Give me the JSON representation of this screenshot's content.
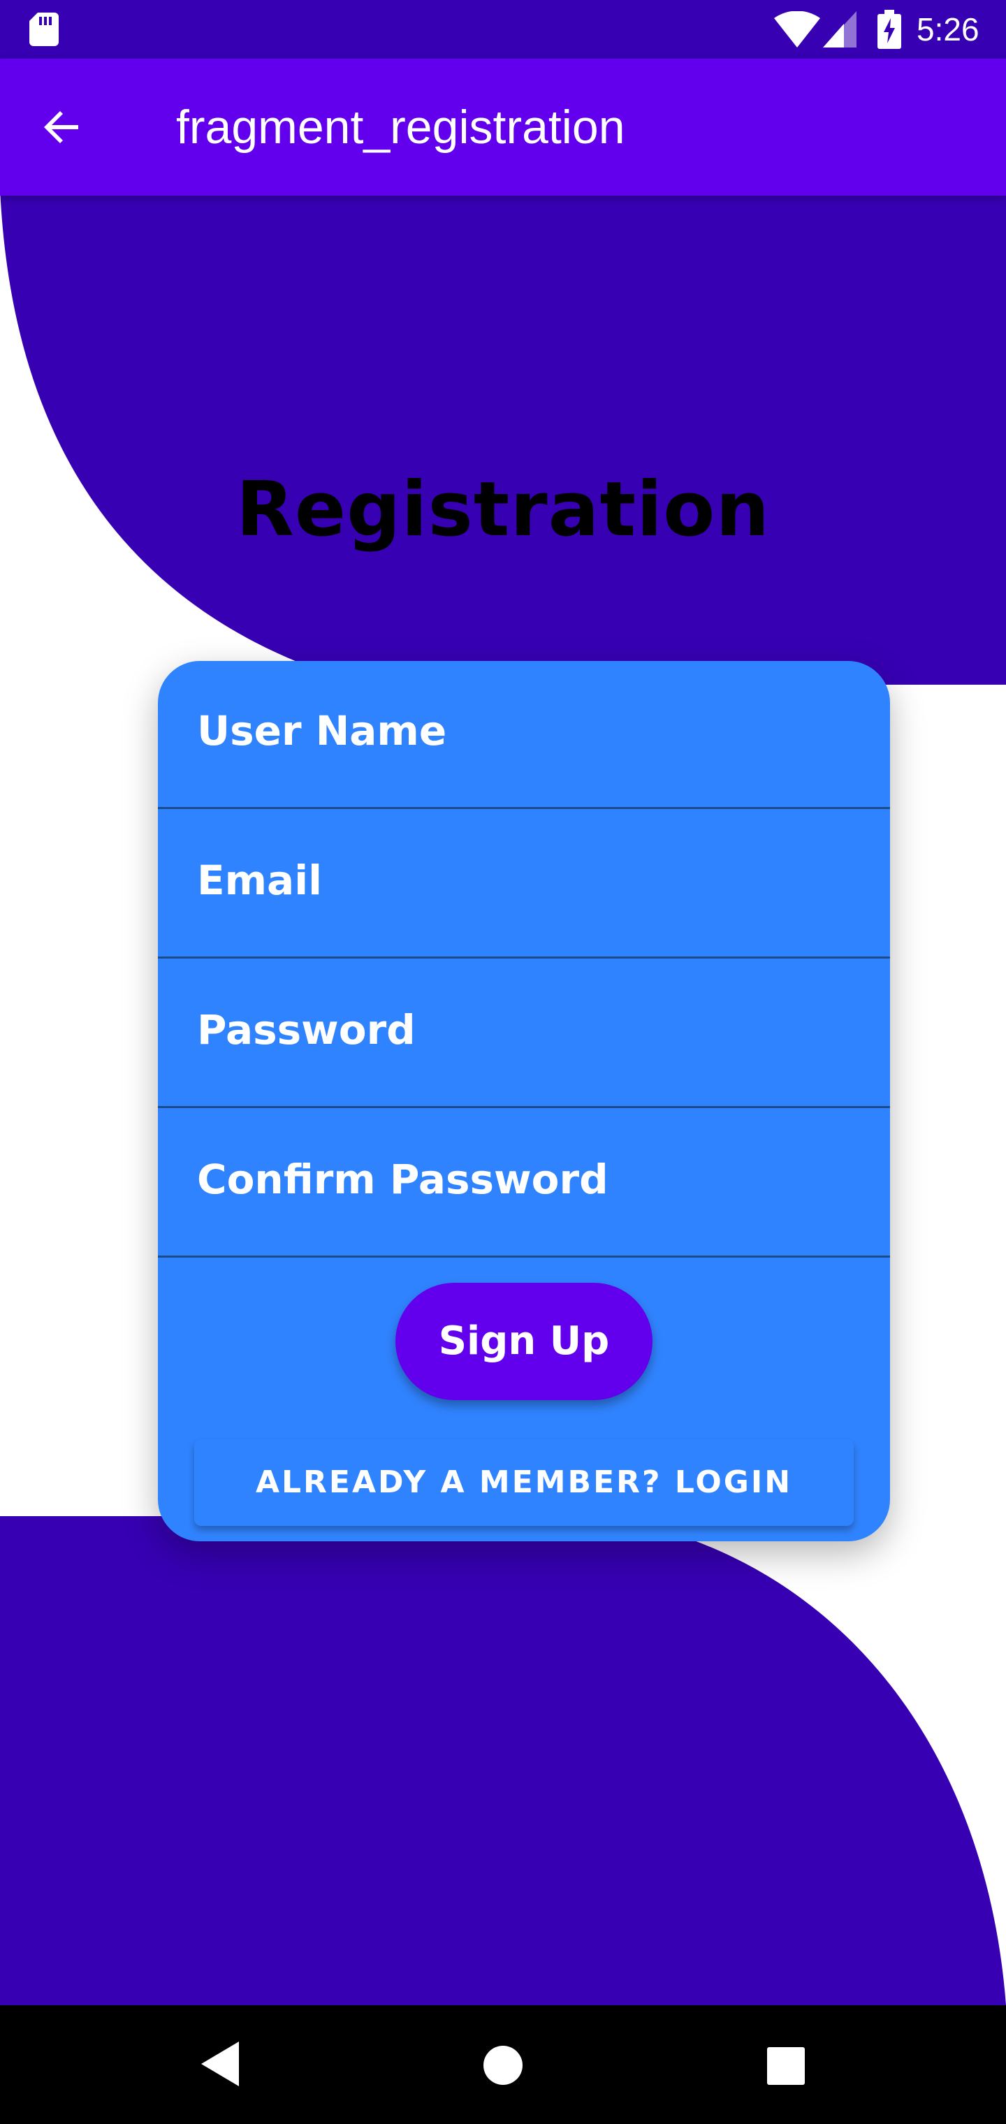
{
  "status_bar": {
    "time": "5:26",
    "icons": [
      "sd-card-icon",
      "wifi-icon",
      "signal-icon",
      "battery-charging-icon"
    ]
  },
  "app_bar": {
    "title": "fragment_registration",
    "back_icon": "arrow-back-icon"
  },
  "page": {
    "title": "Registration"
  },
  "form": {
    "username_placeholder": "User Name",
    "email_placeholder": "Email",
    "password_placeholder": "Password",
    "confirm_password_placeholder": "Confirm Password",
    "signup_label": "Sign Up",
    "login_label": "ALREADY A MEMBER? LOGIN"
  },
  "nav_bar": {
    "icons": [
      "nav-back-icon",
      "nav-home-icon",
      "nav-recents-icon"
    ]
  },
  "colors": {
    "status_bar": "#3700b3",
    "app_bar": "#6200ee",
    "background_shape": "#3700b3",
    "card": "#3083fe",
    "signup_button": "#6200ee",
    "title_text": "#000000",
    "field_text": "#ffffff"
  }
}
